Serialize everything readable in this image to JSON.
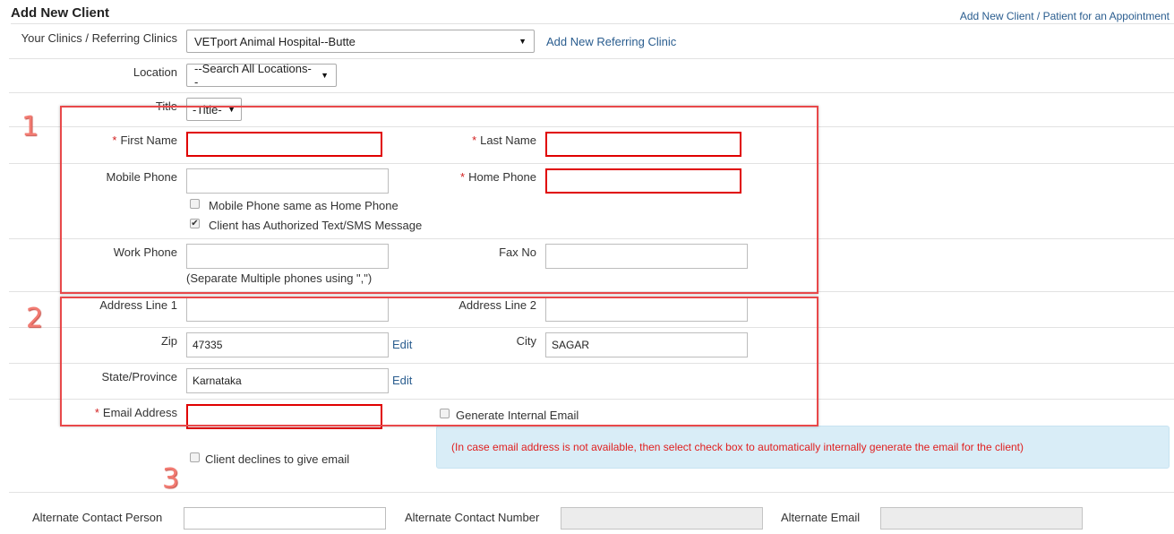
{
  "page": {
    "title": "Add New Client",
    "top_link": "Add New Client / Patient for an Appointment"
  },
  "clinic": {
    "label": "Your Clinics / Referring Clinics",
    "selected": "VETport Animal Hospital--Butte",
    "add_link": "Add New Referring Clinic"
  },
  "location": {
    "label": "Location",
    "selected": "--Search All Locations--"
  },
  "title_field": {
    "label": "Title",
    "selected": "-Title-"
  },
  "required_mark": "*",
  "first_name": {
    "label": "First Name",
    "value": ""
  },
  "last_name": {
    "label": "Last Name",
    "value": ""
  },
  "mobile_phone": {
    "label": "Mobile Phone",
    "value": ""
  },
  "home_phone": {
    "label": "Home Phone",
    "value": ""
  },
  "checkboxes": {
    "mobile_same_home": {
      "label": "Mobile Phone same as Home Phone",
      "checked": false
    },
    "sms_authorized": {
      "label": "Client has Authorized Text/SMS Message",
      "checked": true,
      "check_glyph": "✔"
    },
    "generate_internal_email": {
      "label": "Generate Internal Email",
      "checked": false
    },
    "declines_email": {
      "label": "Client declines to give email",
      "checked": false
    }
  },
  "work_phone": {
    "label": "Work Phone",
    "value": ""
  },
  "phone_hint": "(Separate Multiple phones using \",\")",
  "fax": {
    "label": "Fax No",
    "value": ""
  },
  "address_line1": {
    "label": "Address Line 1",
    "value": ""
  },
  "address_line2": {
    "label": "Address Line 2",
    "value": ""
  },
  "zip": {
    "label": "Zip",
    "value": "47335",
    "edit": "Edit"
  },
  "city": {
    "label": "City",
    "value": "SAGAR"
  },
  "state": {
    "label": "State/Province",
    "value": "Karnataka",
    "edit": "Edit"
  },
  "email": {
    "label": "Email Address",
    "value": ""
  },
  "email_info": "(In case email address is not available, then select check box to automatically internally generate the email for the client)",
  "alternate": {
    "person_label": "Alternate Contact Person",
    "person_value": "",
    "number_label": "Alternate Contact Number",
    "number_value": "",
    "email_label": "Alternate Email",
    "email_value": ""
  },
  "annotations": {
    "n1": "1",
    "n2": "2",
    "n3": "3"
  },
  "colors": {
    "link": "#2a5d8f",
    "required": "#d21f1f",
    "annotation_box": "#e8484a",
    "info_bg": "#d9edf7",
    "info_text": "#e02020"
  }
}
